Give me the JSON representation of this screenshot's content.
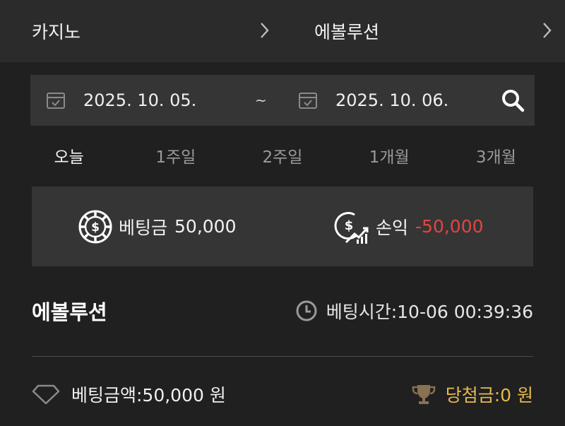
{
  "breadcrumb": {
    "category": "카지노",
    "game": "에볼루션",
    "chevron_icon": "chevron-right-icon"
  },
  "date_filter": {
    "start_date": "2025. 10. 05.",
    "separator": "~",
    "end_date": "2025. 10. 06.",
    "calendar_icon": "calendar-check-icon",
    "search_icon": "search-icon"
  },
  "period_tabs": [
    {
      "label": "오늘",
      "active": true
    },
    {
      "label": "1주일",
      "active": false
    },
    {
      "label": "2주일",
      "active": false
    },
    {
      "label": "1개월",
      "active": false
    },
    {
      "label": "3개월",
      "active": false
    }
  ],
  "summary": {
    "bet_label": "베팅금",
    "bet_value": "50,000",
    "profit_label": "손익",
    "profit_value": "-50,000",
    "profit_color": "#e0463f"
  },
  "record": {
    "game_name": "에볼루션",
    "bet_time": "베팅시간:10-06 00:39:36",
    "bet_amount": "베팅금액:50,000 원",
    "winnings": "당첨금:0 원",
    "winnings_color": "#e8b94e"
  }
}
